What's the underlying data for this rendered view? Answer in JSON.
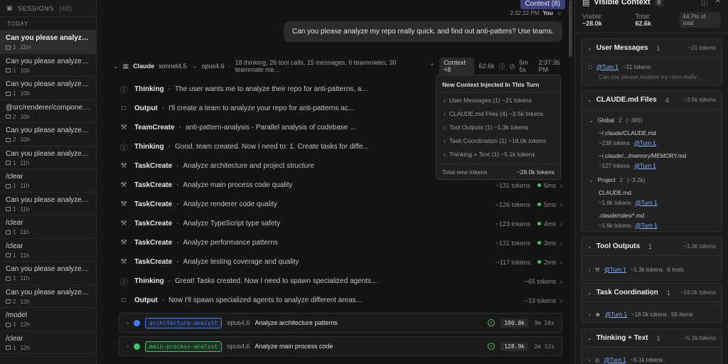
{
  "sidebar": {
    "title": "SESSIONS",
    "count": "(48)",
    "group": "TODAY",
    "sessions": [
      {
        "title": "Can you please analyze m...",
        "msgs": "1",
        "time": "11m",
        "active": true
      },
      {
        "title": "Can you please analyze m...",
        "msgs": "1",
        "time": "10h"
      },
      {
        "title": "Can you please analyze m...",
        "msgs": "1",
        "time": "10h"
      },
      {
        "title": "@src/renderer/component...",
        "msgs": "2",
        "time": "10h"
      },
      {
        "title": "Can you please analyze m...",
        "msgs": "2",
        "time": "10h"
      },
      {
        "title": "Can you please analyze m...",
        "msgs": "1",
        "time": "11h"
      },
      {
        "title": "/clear",
        "msgs": "1",
        "time": "11h"
      },
      {
        "title": "Can you please analyze m...",
        "msgs": "1",
        "time": "11h"
      },
      {
        "title": "/clear",
        "msgs": "1",
        "time": "11h"
      },
      {
        "title": "/clear",
        "msgs": "1",
        "time": "11h"
      },
      {
        "title": "Can you please analyze m...",
        "msgs": "1",
        "time": "11h"
      },
      {
        "title": "Can you please analyze en...",
        "msgs": "2",
        "time": "12h"
      },
      {
        "title": "/model",
        "msgs": "1",
        "time": "12h"
      },
      {
        "title": "/clear",
        "msgs": "1",
        "time": "12h"
      }
    ]
  },
  "main": {
    "context_badge": "Context (8)",
    "user_time": "2:32:22 PM",
    "user_label": "You",
    "user_message": "Can you please analyze my repo really quick, and find out anti-patters? Use teams.",
    "turn": {
      "agent": "Claude",
      "from_model": "sonnet4.5",
      "to_model": "opus4.6",
      "summary": "18 thinking, 26 tool calls, 15 messages, 6 teammates, 30 teammate me...",
      "context_pill": "Context +8",
      "tokens": "62.6k",
      "duration": "5m 5s",
      "time": "2:37:36 PM"
    },
    "rows": [
      {
        "icon": "thinking",
        "name": "Thinking",
        "desc": "The user wants me to analyze their repo for anti-patterns, a...",
        "tokens": "",
        "dur": ""
      },
      {
        "icon": "output",
        "name": "Output",
        "desc": "I'll create a team to analyze your repo for anti-patterns ac...",
        "tokens": "",
        "dur": ""
      },
      {
        "icon": "tool",
        "name": "TeamCreate",
        "desc": "anti-pattern-analysis - Parallel analysis of codebase ...",
        "tokens": "",
        "dur": ""
      },
      {
        "icon": "thinking",
        "name": "Thinking",
        "desc": "Good, team created. Now I need to: 1. Create tasks for diffe...",
        "tokens": "",
        "dur": ""
      },
      {
        "icon": "tool",
        "name": "TaskCreate",
        "desc": "Analyze architecture and project structure",
        "tokens": "",
        "dur": ""
      },
      {
        "icon": "tool",
        "name": "TaskCreate",
        "desc": "Analyze main process code quality",
        "tokens": "~131 tokens",
        "dur": "6ms"
      },
      {
        "icon": "tool",
        "name": "TaskCreate",
        "desc": "Analyze renderer code quality",
        "tokens": "~126 tokens",
        "dur": "5ms"
      },
      {
        "icon": "tool",
        "name": "TaskCreate",
        "desc": "Analyze TypeScript type safety",
        "tokens": "~123 tokens",
        "dur": "4ms"
      },
      {
        "icon": "tool",
        "name": "TaskCreate",
        "desc": "Analyze performance patterns",
        "tokens": "~131 tokens",
        "dur": "3ms"
      },
      {
        "icon": "tool",
        "name": "TaskCreate",
        "desc": "Analyze testing coverage and quality",
        "tokens": "~117 tokens",
        "dur": "2ms"
      },
      {
        "icon": "thinking",
        "name": "Thinking",
        "desc": "Great! Tasks created. Now I need to spawn specialized agents...",
        "tokens": "~65 tokens",
        "dur": ""
      },
      {
        "icon": "output",
        "name": "Output",
        "desc": "Now I'll spawn specialized agents to analyze different areas...",
        "tokens": "~19 tokens",
        "dur": ""
      }
    ],
    "agents": [
      {
        "tag": "architecture-analyst",
        "model": "opus4.6",
        "title": "Analyze architecture patterns",
        "tokens": "100.8k",
        "time": "3m 10s",
        "color": "#4a7bf0"
      },
      {
        "tag": "main-process-analyst",
        "model": "opus4.6",
        "title": "Analyze main process code",
        "tokens": "128.9k",
        "time": "2m 12s",
        "color": "#43c06a"
      }
    ],
    "popup": {
      "title": "New Context Injected In This Turn",
      "items": [
        "User Messages (1) ~21 tokens",
        "CLAUDE.md Files (4) ~3.5k tokens",
        "Tool Outputs (1) ~1.3k tokens",
        "Task Coordination (1) ~18.0k tokens",
        "Thinking + Text (1) ~5.1k tokens"
      ],
      "total_label": "Total new tokens",
      "total_value": "~28.0k tokens"
    }
  },
  "right": {
    "title": "Visible Context",
    "count": "8",
    "visible_label": "Visible:",
    "visible_value": "~28.0k",
    "total_label": "Total:",
    "total_value": "62.6k",
    "pct": "44.7% of total",
    "user_messages": {
      "title": "User Messages",
      "count": "1",
      "tokens": "~21 tokens",
      "turn": "@Turn 1",
      "turn_tokens": "~21 tokens",
      "preview": "Can you please analyze my repo really ..."
    },
    "claude_md": {
      "title": "CLAUDE.md Files",
      "count": "4",
      "tokens": "~3.5k tokens",
      "global_label": "Global",
      "global_count": "2",
      "global_tokens": "(~365)",
      "global_files": [
        {
          "name": "~/.claude/CLAUDE.md",
          "tokens": "~238 tokens",
          "turn": "@Turn 1"
        },
        {
          "name": "~/.claude/.../memory/MEMORY.md",
          "tokens": "~127 tokens",
          "turn": "@Turn 1"
        }
      ],
      "project_label": "Project",
      "project_count": "2",
      "project_tokens": "(~3.2k)",
      "project_files": [
        {
          "name": "CLAUDE.md",
          "tokens": "~1.6k tokens",
          "turn": "@Turn 1"
        },
        {
          "name": ".claude/rules/*.md",
          "tokens": "~1.6k tokens",
          "turn": "@Turn 1"
        }
      ]
    },
    "tool_outputs": {
      "title": "Tool Outputs",
      "count": "1",
      "tokens": "~1.3k tokens",
      "turn": "@Turn 1",
      "turn_tokens": "~1.3k tokens",
      "extra": "6 tools"
    },
    "task_coord": {
      "title": "Task Coordination",
      "count": "1",
      "tokens": "~18.0k tokens",
      "turn": "@Turn 1",
      "turn_tokens": "~18.0k tokens",
      "extra": "56 items"
    },
    "thinking_text": {
      "title": "Thinking + Text",
      "count": "1",
      "tokens": "~5.1k tokens",
      "turn": "@Turn 1",
      "turn_tokens": "~5.1k tokens"
    }
  }
}
